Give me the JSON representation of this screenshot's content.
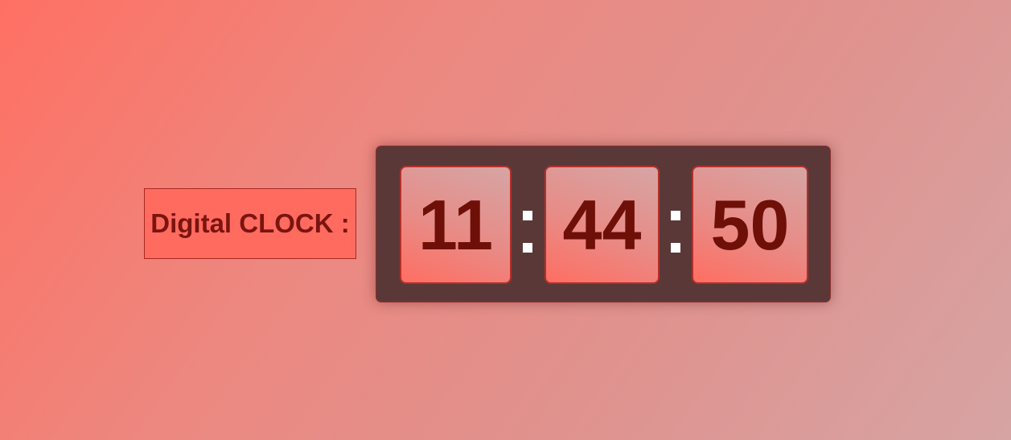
{
  "label": {
    "text": "Digital CLOCK :"
  },
  "clock": {
    "hours": "11",
    "minutes": "44",
    "seconds": "50"
  },
  "colors": {
    "background_start": "#ff7063",
    "background_end": "#d6a4a3",
    "panel": "#5a3838",
    "digit_text": "#6e0f08",
    "separator": "#ffffff"
  }
}
